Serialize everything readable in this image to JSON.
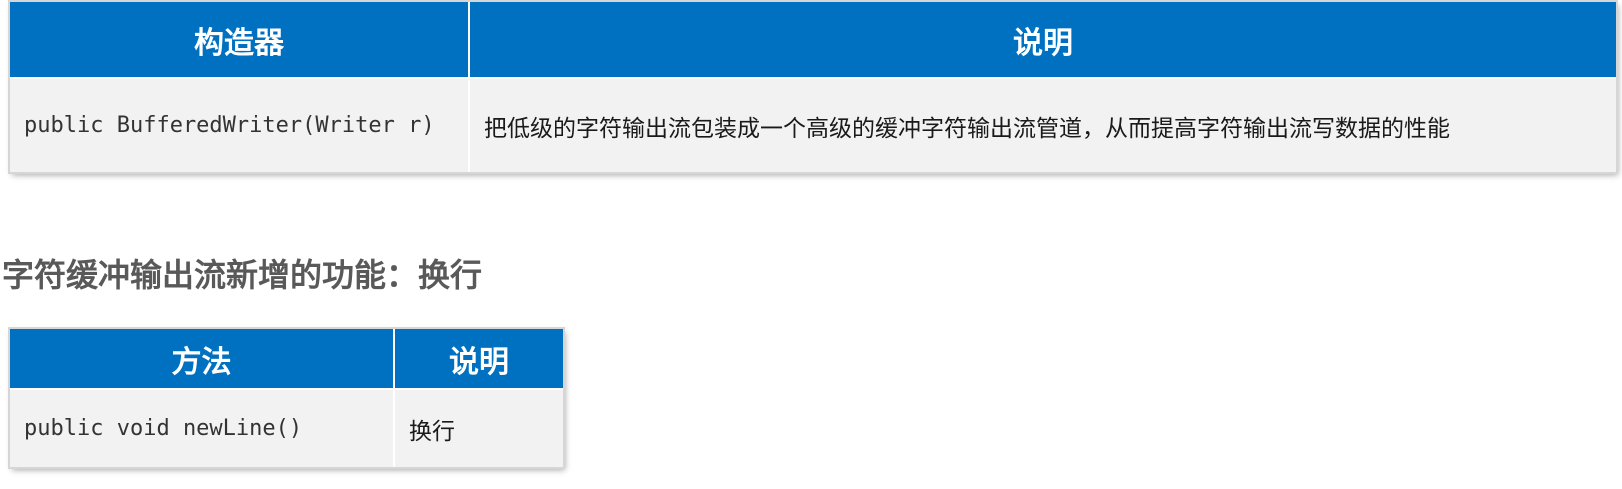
{
  "constructor_table": {
    "headers": [
      "构造器",
      "说明"
    ],
    "rows": [
      {
        "signature": "public BufferedWriter(Writer r)",
        "description": "把低级的字符输出流包装成一个高级的缓冲字符输出流管道，从而提高字符输出流写数据的性能"
      }
    ]
  },
  "section": {
    "heading": "字符缓冲输出流新增的功能：换行"
  },
  "method_table": {
    "headers": [
      "方法",
      "说明"
    ],
    "rows": [
      {
        "signature": "public void newLine()",
        "description": "换行"
      }
    ]
  },
  "colors": {
    "header_bg": "#0070c0",
    "header_text": "#ffffff",
    "row_bg": "#f2f2f2",
    "heading_text": "#595959"
  }
}
